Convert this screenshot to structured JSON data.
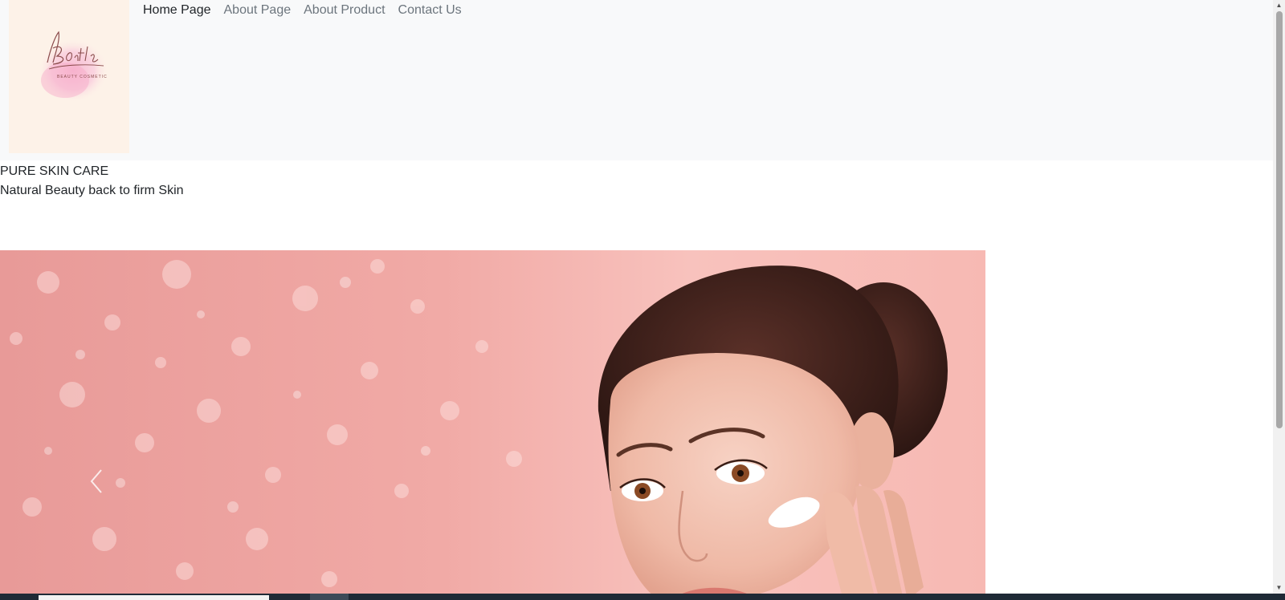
{
  "nav": {
    "logo_alt": "Bontle Beauty Cosmetic logo",
    "logo_script": "Bontle",
    "logo_sub": "BEAUTY COSMETIC",
    "links": [
      {
        "label": "Home Page",
        "active": true
      },
      {
        "label": "About Page",
        "active": false
      },
      {
        "label": "About Product",
        "active": false
      },
      {
        "label": "Contact Us",
        "active": false
      }
    ]
  },
  "hero": {
    "heading": "PURE SKIN CARE",
    "subheading": "Natural Beauty back to firm Skin"
  },
  "carousel": {
    "image_alt": "Woman applying cream to cheek on pink glitter background",
    "prev_icon": "chevron-left-icon"
  },
  "colors": {
    "navbar_bg": "#f8f9fa",
    "logo_bg": "#fdf2e8",
    "carousel_bg": "#f4b4b0",
    "active_link": "#212529",
    "inactive_link": "#6c757d"
  }
}
